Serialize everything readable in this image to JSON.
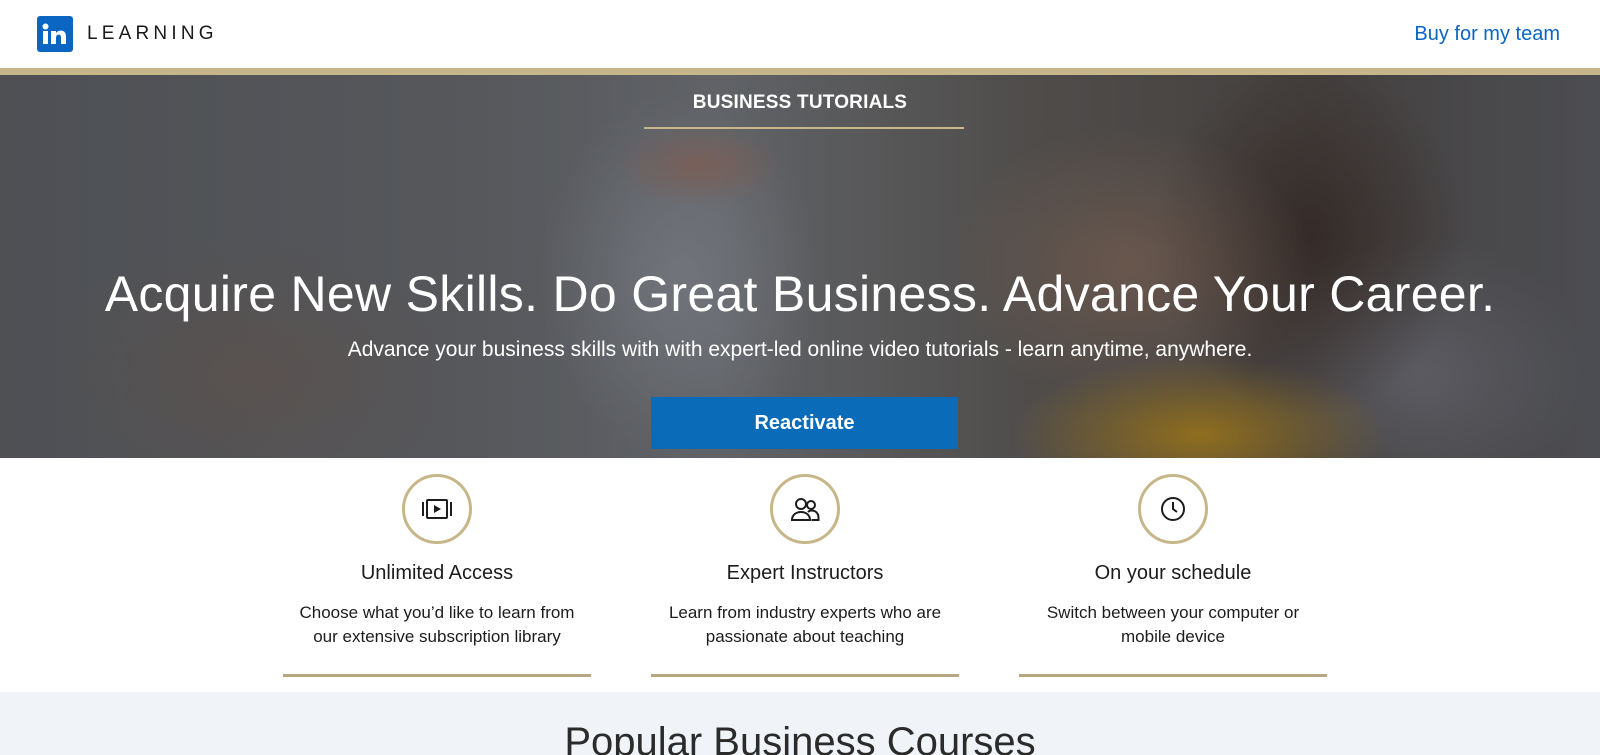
{
  "header": {
    "logo_text": "in",
    "brand_word": "LEARNING",
    "team_link": "Buy for my team"
  },
  "hero": {
    "section_label": "BUSINESS TUTORIALS",
    "headline": "Acquire New Skills. Do Great Business. Advance Your Career.",
    "subline": "Advance your business skills with with expert-led online video tutorials - learn anytime, anywhere.",
    "cta_label": "Reactivate"
  },
  "features": [
    {
      "icon": "video-library-icon",
      "title": "Unlimited Access",
      "desc_line1": "Choose what you’d like to learn from",
      "desc_line2": "our extensive subscription library"
    },
    {
      "icon": "instructors-icon",
      "title": "Expert Instructors",
      "desc_line1": "Learn from industry experts who are",
      "desc_line2": "passionate about teaching"
    },
    {
      "icon": "clock-icon",
      "title": "On your schedule",
      "desc_line1": "Switch between your computer or",
      "desc_line2": "mobile device"
    }
  ],
  "popular": {
    "title": "Popular Business Courses"
  },
  "colors": {
    "brand_blue": "#0a66c2",
    "cta_blue": "#0a6bb8",
    "gold_accent": "#c7b68a",
    "section_bg": "#f0f3f7"
  }
}
